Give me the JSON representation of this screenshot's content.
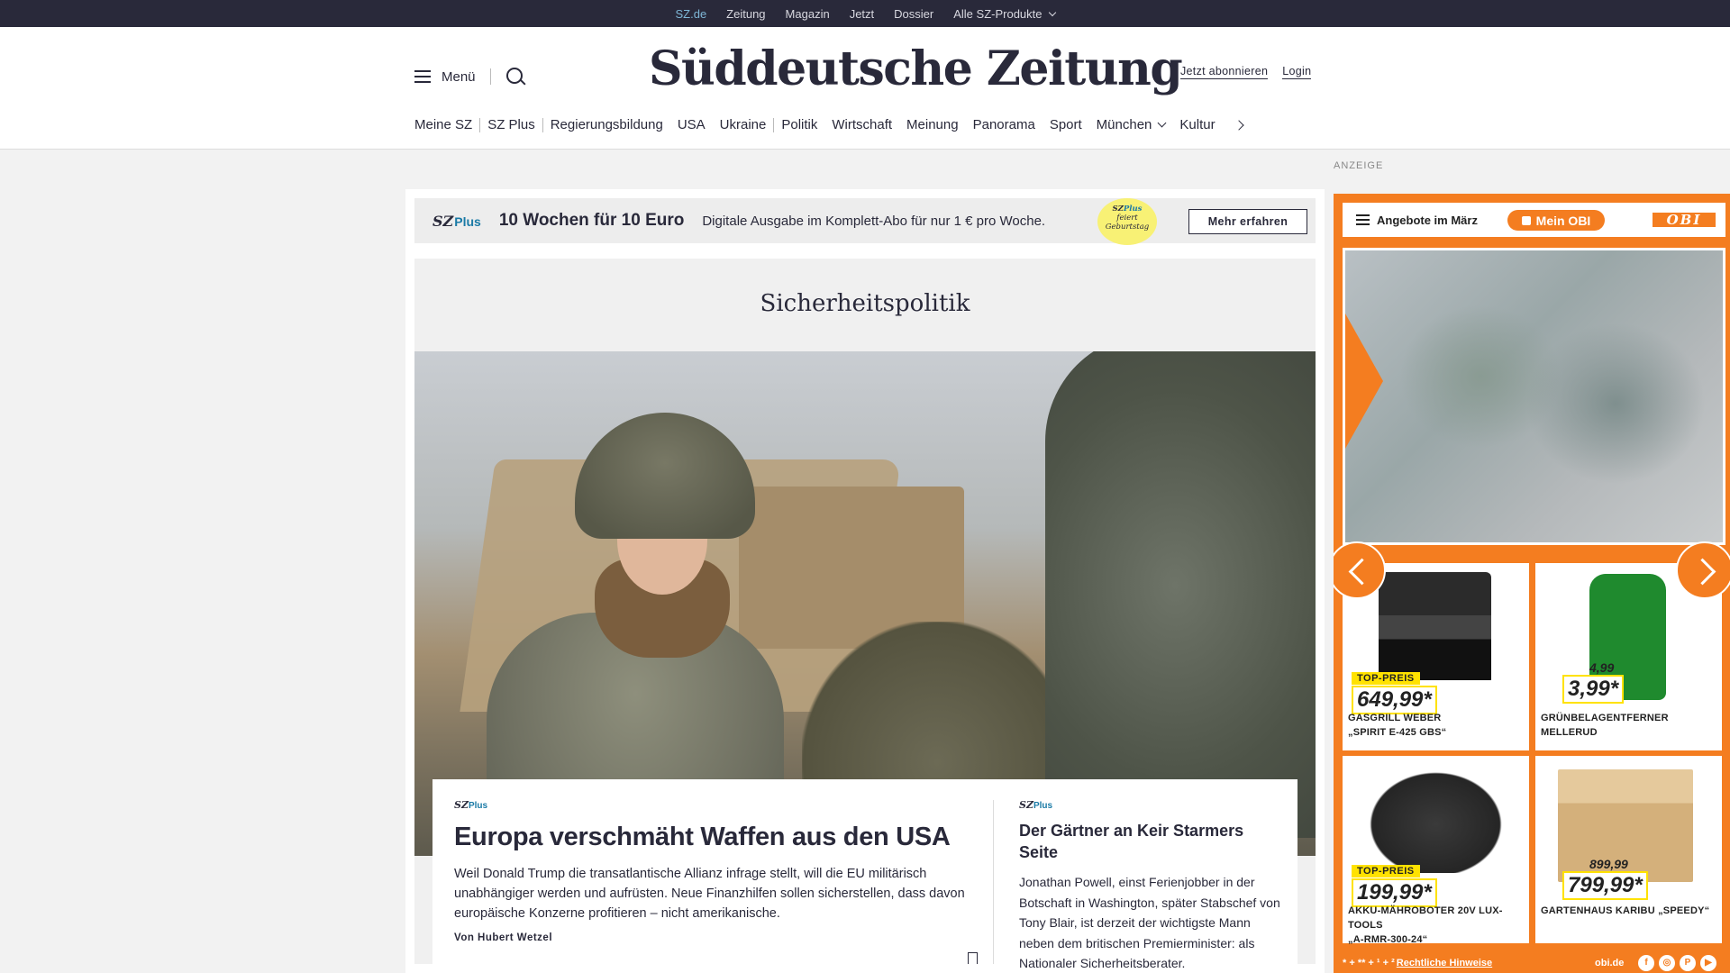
{
  "topbar": {
    "links": [
      "SZ.de",
      "Zeitung",
      "Magazin",
      "Jetzt",
      "Dossier",
      "Alle SZ-Produkte"
    ]
  },
  "header": {
    "menu_label": "Menü",
    "logo": "Süddeutsche Zeitung",
    "subscribe": "Jetzt abonnieren",
    "login": "Login"
  },
  "nav": {
    "items": [
      "Meine SZ",
      "SZ Plus",
      "Regierungsbildung",
      "USA",
      "Ukraine",
      "Politik",
      "Wirtschaft",
      "Meinung",
      "Panorama",
      "Sport",
      "München",
      "Kultur"
    ]
  },
  "ad_label": "ANZEIGE",
  "promo": {
    "brand": "SZ",
    "brand_plus": "Plus",
    "offer": "10 Wochen für 10 Euro",
    "description": "Digitale Ausgabe im Komplett-Abo für nur 1 € pro Woche.",
    "badge_brand": "SZ",
    "badge_plus": "Plus",
    "badge_line1": "feiert",
    "badge_line2": "Geburtstag",
    "cta": "Mehr erfahren"
  },
  "section": {
    "title": "Sicherheitspolitik"
  },
  "lead_article": {
    "brand": "SZ",
    "brand_plus": "Plus",
    "headline": "Europa verschmäht Waffen aus den USA",
    "teaser": "Weil Donald Trump die transatlantische Allianz infrage stellt, will die EU militärisch unabhängiger werden und aufrüsten. Neue Finanzhilfen sollen sicherstellen, dass davon europäische Konzerne profitieren – nicht amerikanische.",
    "author": "Von Hubert Wetzel"
  },
  "side_article": {
    "brand": "SZ",
    "brand_plus": "Plus",
    "headline": "Der Gärtner an Keir Starmers Seite",
    "teaser": "Jonathan Powell, einst Ferienjobber in der Botschaft in Washington, später Stabschef von Tony Blair, ist derzeit der wichtigste Mann neben dem britischen Premierminister: als Nationaler Sicherheitsberater."
  },
  "obi_ad": {
    "menu_label": "Angebote im März",
    "mein_obi": "Mein OBI",
    "logo": "OBI",
    "products": [
      {
        "tag": "TOP-PREIS",
        "price": "649,99*",
        "name_line1": "GASGRILL WEBER",
        "name_line2": "„SPIRIT E-425 GBS“"
      },
      {
        "old_price": "4,99",
        "price": "3,99*",
        "name_line1": "GRÜNBELAGENTFERNER",
        "name_line2": "MELLERUD"
      },
      {
        "tag": "TOP-PREIS",
        "price": "199,99*",
        "name_line1": "AKKU-MÄHROBOTER 20V LUX-TOOLS",
        "name_line2": "„A-RMR-300-24“"
      },
      {
        "old_price": "899,99",
        "price": "799,99*",
        "name_line1": "GARTENHAUS KARIBU „SPEEDY“",
        "name_line2": ""
      }
    ],
    "footer_marks": "* + ** + ¹ + ²",
    "footer_link": "Rechtliche Hinweise",
    "domain": "obi.de",
    "social": [
      "f",
      "◎",
      "P",
      "▶"
    ]
  }
}
